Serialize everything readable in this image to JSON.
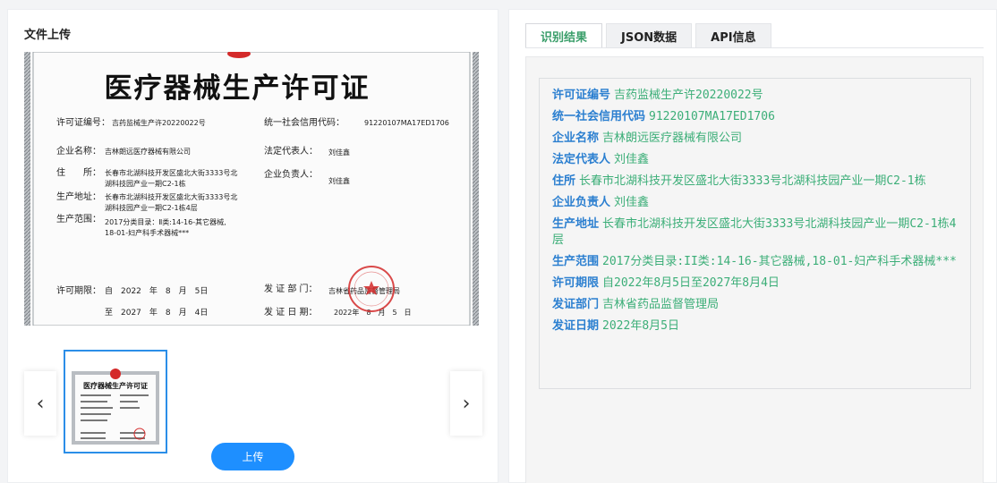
{
  "left": {
    "title": "文件上传",
    "upload_label": "上传",
    "prev_label": "‹",
    "next_label": "›"
  },
  "certificate": {
    "heading": "医疗器械生产许可证",
    "license_no_label": "许可证编号：",
    "license_no": "吉药监械生产许20220022号",
    "credit_code_label": "统一社会信用代码：",
    "credit_code": "91220107MA17ED1706",
    "company_label": "企业名称：",
    "company": "吉林朗远医疗器械有限公司",
    "legal_rep_label": "法定代表人：",
    "legal_rep": "刘佳鑫",
    "address_label": "住　　所：",
    "address_1": "长春市北湖科技开发区盛北大街3333号北",
    "address_2": "湖科技园产业一期C2-1栋",
    "principal_label": "企业负责人：",
    "principal": "刘佳鑫",
    "prod_addr_label": "生产地址：",
    "prod_addr_1": "长春市北湖科技开发区盛北大街3333号北",
    "prod_addr_2": "湖科技园产业一期C2-1栋4层",
    "scope_label": "生产范围：",
    "scope_1": "2017分类目录：Ⅱ类:14-16-其它器械,",
    "scope_2": "18-01-妇产科手术器械***",
    "validity_label": "许可期限：",
    "validity_from": "自　2022　年　8　月　5日",
    "validity_to": "至　2027　年　8　月　4日",
    "issuer_label": "发 证 部 门：",
    "issuer": "吉林省药品监督管理局",
    "issue_date_label": "发 证 日 期：",
    "issue_date": "2022年　8　月　5　日"
  },
  "right": {
    "tabs": [
      {
        "label": "识别结果",
        "active": true
      },
      {
        "label": "JSON数据",
        "active": false
      },
      {
        "label": "API信息",
        "active": false
      }
    ],
    "fields": [
      {
        "key": "许可证编号",
        "value": "吉药监械生产许20220022号"
      },
      {
        "key": "统一社会信用代码",
        "value": "91220107MA17ED1706"
      },
      {
        "key": "企业名称",
        "value": "吉林朗远医疗器械有限公司"
      },
      {
        "key": "法定代表人",
        "value": "刘佳鑫"
      },
      {
        "key": "住所",
        "value": "长春市北湖科技开发区盛北大街3333号北湖科技园产业一期C2-1栋"
      },
      {
        "key": "企业负责人",
        "value": "刘佳鑫"
      },
      {
        "key": "生产地址",
        "value": "长春市北湖科技开发区盛北大街3333号北湖科技园产业一期C2-1栋4层"
      },
      {
        "key": "生产范围",
        "value": "2017分类目录:II类:14-16-其它器械,18-01-妇产科手术器械***"
      },
      {
        "key": "许可期限",
        "value": "自2022年8月5日至2027年8月4日"
      },
      {
        "key": "发证部门",
        "value": "吉林省药品监督管理局"
      },
      {
        "key": "发证日期",
        "value": "2022年8月5日"
      }
    ]
  },
  "colors": {
    "accent": "#1e8fff",
    "key_text": "#2b7fd0",
    "value_text": "#3cae78",
    "seal": "#d42a2a"
  }
}
